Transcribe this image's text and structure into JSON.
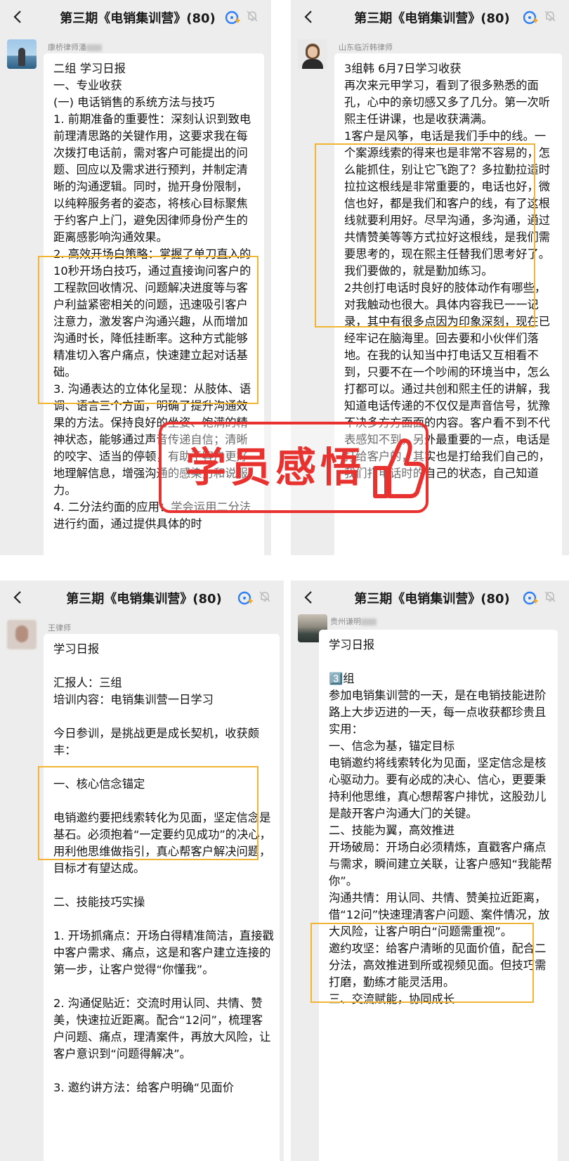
{
  "panels": [
    {
      "title": "第三期《电销集训营》(80)",
      "sender": "康桥律师潘",
      "message": "二组 学习日报\n一、专业收获\n(一) 电话销售的系统方法与技巧\n1. 前期准备的重要性：深刻认识到致电前理清思路的关键作用，这要求我在每次拨打电话前，需对客户可能提出的问题、回应以及需求进行预判，并制定清晰的沟通逻辑。同时，抛开身份限制，以纯粹服务者的姿态，将核心目标聚焦于约客户上门，避免因律师身份产生的距离感影响沟通效果。\n2. 高效开场白策略：掌握了单刀直入的10秒开场白技巧，通过直接询问客户的工程款回收情况、问题解决进度等与客户利益紧密相关的问题，迅速吸引客户注意力，激发客户沟通兴趣，从而增加沟通时长，降低挂断率。这种方式能够精准切入客户痛点，快速建立起对话基础。\n3. 沟通表达的立体化呈现：从肢体、语调、语言三个方面，明确了提升沟通效果的方法。保持良好的坐姿、饱满的精神状态，能够通过声音传递自信；清晰的咬字、适当的停顿，有助于客户更好地理解信息，增强沟通的感染力和说服力。\n4. 二分法约面的应用：学会运用二分法进行约面，通过提供具体的时"
    },
    {
      "title": "第三期《电销集训营》(80)",
      "sender": "山东临沂韩律师",
      "message": "3组韩 6月7日学习收获\n再次来元甲学习，看到了很多熟悉的面孔，心中的亲切感又多了几分。第一次听熙主任讲课，也是收获满满。\n1客户是风筝，电话是我们手中的线。一个案源线索的得来也是非常不容易的，怎么能抓住，别让它飞跑了？多拉勤拉适时拉拉这根线是非常重要的，电话也好，微信也好，都是我们和客户的线，有了这根线就要利用好。尽早沟通，多沟通，通过共情赞美等等方式拉好这根线，是我们需要思考的，现在熙主任替我们思考好了。我们要做的，就是勤加练习。\n2共创打电话时良好的肢体动作有哪些，对我触动也很大。具体内容我已一一记录，其中有很多点因为印象深刻，现在已经牢记在脑海里。回去要和小伙伴们落地。在我的认知当中打电话又互相看不到，只要不在一个吵闹的环境当中，怎么打都可以。通过共创和熙主任的讲解，我知道电话传递的不仅仅是声音信号，犹豫不决多方方面面的内容。客户看不到不代表感知不到，另外最重要的一点，电话是打给客户的，其实也是打给我们自己的，我们打电话时的自己的状态，自己知道"
    },
    {
      "title": "第三期《电销集训营》(80)",
      "sender": "王律师",
      "message": "学习日报\n\n汇报人：三组\n培训内容：电销集训营一日学习\n\n今日参训，是挑战更是成长契机，收获颇丰：\n\n一、核心信念锚定\n\n电销邀约要把线索转化为见面，坚定信念是基石。必须抱着“一定要约见成功”的决心，用利他思维做指引，真心帮客户解决问题，目标才有望达成。\n\n二、技能技巧实操\n\n1. 开场抓痛点：开场白得精准简洁，直接戳中客户需求、痛点，这是和客户建立连接的第一步，让客户觉得“你懂我”。\n\n2. 沟通促贴近：交流时用认同、共情、赞美，快速拉近距离。配合“12问”，梳理客户问题、痛点，理清案件，再放大风险，让客户意识到“问题得解决”。\n\n3. 邀约讲方法：给客户明确“见面价"
    },
    {
      "title": "第三期《电销集训营》(80)",
      "sender": "贵州谦明",
      "message": "学习日报\n\n3️⃣组\n参加电销集训营的一天，是在电销技能进阶路上大步迈进的一天，每一点收获都珍贵且实用：\n一、信念为基，锚定目标\n电销邀约将线索转化为见面，坚定信念是核心驱动力。要有必成的决心、信心，更要秉持利他思维，真心想帮客户排忧，这股劲儿是敲开客户沟通大门的关键。\n二、技能为翼，高效推进\n开场破局：开场白必须精炼，直戳客户痛点与需求，瞬间建立关联，让客户感知“我能帮你”。\n沟通共情：用认同、共情、赞美拉近距离，借“12问”快速理清客户问题、案件情况，放大风险，让客户明白“问题需重视”。\n邀约攻坚：给客户清晰的见面价值，配合二分法，高效推进到所或视频见面。但技巧需打磨，勤练才能灵活用。\n三、交流赋能，协同成长"
    }
  ],
  "stamp": {
    "text": "学员感悟",
    "color": "#e8322f",
    "icon": "thumbs-up-icon"
  },
  "colors": {
    "highlight": "#f1b533",
    "chat_bg": "#ededed",
    "spark_blue": "#2f7ff5"
  }
}
